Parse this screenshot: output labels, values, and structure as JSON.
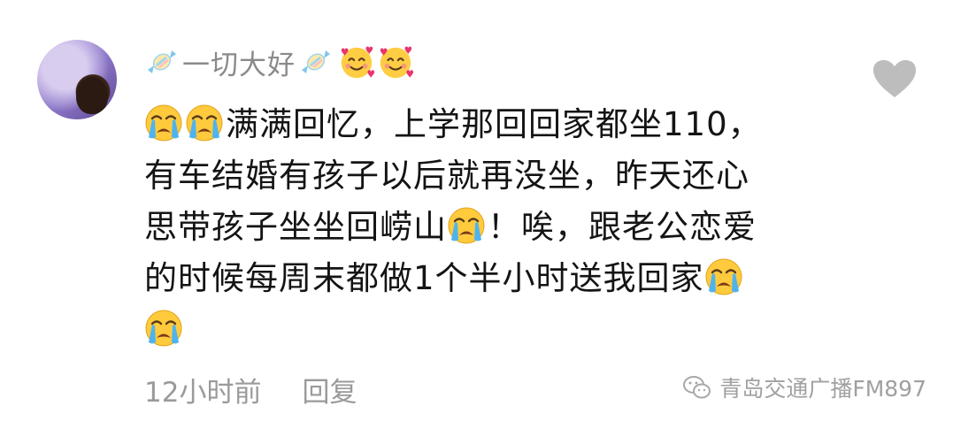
{
  "comment": {
    "username": "一切大好",
    "text": {
      "line1": "满满回忆，上学那回回家都坐110，",
      "line2": "有车结婚有孩子以后就再没坐，昨天还心",
      "line3a": "思带孩子坐坐回崂山",
      "line3b": "！唉，跟老公恋爱",
      "line4": "的时候每周末都做1个半小时送我回家"
    },
    "timestamp": "12小时前",
    "reply_label": "回复"
  },
  "watermark": {
    "text": "青岛交通广播FM897"
  },
  "icons": {
    "like": "heart-icon",
    "candy": "candy-icon",
    "face": "smiling-face-with-hearts-icon",
    "cry": "loudly-crying-face-icon",
    "wechat": "wechat-icon"
  },
  "colors": {
    "username": "#8a8a8a",
    "body_text": "#141414",
    "meta_text": "#9a9a9a",
    "heart": "#bdbdbd"
  }
}
